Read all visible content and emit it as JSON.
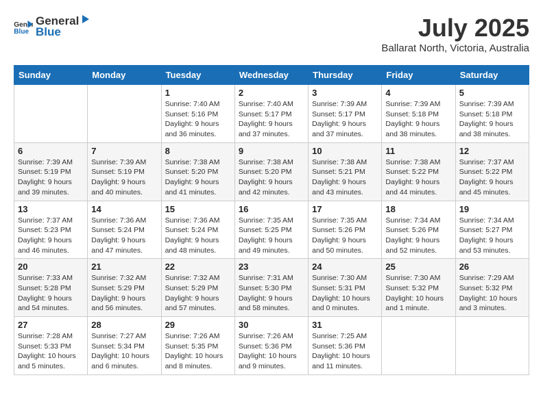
{
  "header": {
    "logo": {
      "general": "General",
      "blue": "Blue"
    },
    "title": "July 2025",
    "location": "Ballarat North, Victoria, Australia"
  },
  "calendar": {
    "days_of_week": [
      "Sunday",
      "Monday",
      "Tuesday",
      "Wednesday",
      "Thursday",
      "Friday",
      "Saturday"
    ],
    "weeks": [
      [
        {
          "day": "",
          "info": ""
        },
        {
          "day": "",
          "info": ""
        },
        {
          "day": "1",
          "info": "Sunrise: 7:40 AM\nSunset: 5:16 PM\nDaylight: 9 hours\nand 36 minutes."
        },
        {
          "day": "2",
          "info": "Sunrise: 7:40 AM\nSunset: 5:17 PM\nDaylight: 9 hours\nand 37 minutes."
        },
        {
          "day": "3",
          "info": "Sunrise: 7:39 AM\nSunset: 5:17 PM\nDaylight: 9 hours\nand 37 minutes."
        },
        {
          "day": "4",
          "info": "Sunrise: 7:39 AM\nSunset: 5:18 PM\nDaylight: 9 hours\nand 38 minutes."
        },
        {
          "day": "5",
          "info": "Sunrise: 7:39 AM\nSunset: 5:18 PM\nDaylight: 9 hours\nand 38 minutes."
        }
      ],
      [
        {
          "day": "6",
          "info": "Sunrise: 7:39 AM\nSunset: 5:19 PM\nDaylight: 9 hours\nand 39 minutes."
        },
        {
          "day": "7",
          "info": "Sunrise: 7:39 AM\nSunset: 5:19 PM\nDaylight: 9 hours\nand 40 minutes."
        },
        {
          "day": "8",
          "info": "Sunrise: 7:38 AM\nSunset: 5:20 PM\nDaylight: 9 hours\nand 41 minutes."
        },
        {
          "day": "9",
          "info": "Sunrise: 7:38 AM\nSunset: 5:20 PM\nDaylight: 9 hours\nand 42 minutes."
        },
        {
          "day": "10",
          "info": "Sunrise: 7:38 AM\nSunset: 5:21 PM\nDaylight: 9 hours\nand 43 minutes."
        },
        {
          "day": "11",
          "info": "Sunrise: 7:38 AM\nSunset: 5:22 PM\nDaylight: 9 hours\nand 44 minutes."
        },
        {
          "day": "12",
          "info": "Sunrise: 7:37 AM\nSunset: 5:22 PM\nDaylight: 9 hours\nand 45 minutes."
        }
      ],
      [
        {
          "day": "13",
          "info": "Sunrise: 7:37 AM\nSunset: 5:23 PM\nDaylight: 9 hours\nand 46 minutes."
        },
        {
          "day": "14",
          "info": "Sunrise: 7:36 AM\nSunset: 5:24 PM\nDaylight: 9 hours\nand 47 minutes."
        },
        {
          "day": "15",
          "info": "Sunrise: 7:36 AM\nSunset: 5:24 PM\nDaylight: 9 hours\nand 48 minutes."
        },
        {
          "day": "16",
          "info": "Sunrise: 7:35 AM\nSunset: 5:25 PM\nDaylight: 9 hours\nand 49 minutes."
        },
        {
          "day": "17",
          "info": "Sunrise: 7:35 AM\nSunset: 5:26 PM\nDaylight: 9 hours\nand 50 minutes."
        },
        {
          "day": "18",
          "info": "Sunrise: 7:34 AM\nSunset: 5:26 PM\nDaylight: 9 hours\nand 52 minutes."
        },
        {
          "day": "19",
          "info": "Sunrise: 7:34 AM\nSunset: 5:27 PM\nDaylight: 9 hours\nand 53 minutes."
        }
      ],
      [
        {
          "day": "20",
          "info": "Sunrise: 7:33 AM\nSunset: 5:28 PM\nDaylight: 9 hours\nand 54 minutes."
        },
        {
          "day": "21",
          "info": "Sunrise: 7:32 AM\nSunset: 5:29 PM\nDaylight: 9 hours\nand 56 minutes."
        },
        {
          "day": "22",
          "info": "Sunrise: 7:32 AM\nSunset: 5:29 PM\nDaylight: 9 hours\nand 57 minutes."
        },
        {
          "day": "23",
          "info": "Sunrise: 7:31 AM\nSunset: 5:30 PM\nDaylight: 9 hours\nand 58 minutes."
        },
        {
          "day": "24",
          "info": "Sunrise: 7:30 AM\nSunset: 5:31 PM\nDaylight: 10 hours\nand 0 minutes."
        },
        {
          "day": "25",
          "info": "Sunrise: 7:30 AM\nSunset: 5:32 PM\nDaylight: 10 hours\nand 1 minute."
        },
        {
          "day": "26",
          "info": "Sunrise: 7:29 AM\nSunset: 5:32 PM\nDaylight: 10 hours\nand 3 minutes."
        }
      ],
      [
        {
          "day": "27",
          "info": "Sunrise: 7:28 AM\nSunset: 5:33 PM\nDaylight: 10 hours\nand 5 minutes."
        },
        {
          "day": "28",
          "info": "Sunrise: 7:27 AM\nSunset: 5:34 PM\nDaylight: 10 hours\nand 6 minutes."
        },
        {
          "day": "29",
          "info": "Sunrise: 7:26 AM\nSunset: 5:35 PM\nDaylight: 10 hours\nand 8 minutes."
        },
        {
          "day": "30",
          "info": "Sunrise: 7:26 AM\nSunset: 5:36 PM\nDaylight: 10 hours\nand 9 minutes."
        },
        {
          "day": "31",
          "info": "Sunrise: 7:25 AM\nSunset: 5:36 PM\nDaylight: 10 hours\nand 11 minutes."
        },
        {
          "day": "",
          "info": ""
        },
        {
          "day": "",
          "info": ""
        }
      ]
    ]
  }
}
